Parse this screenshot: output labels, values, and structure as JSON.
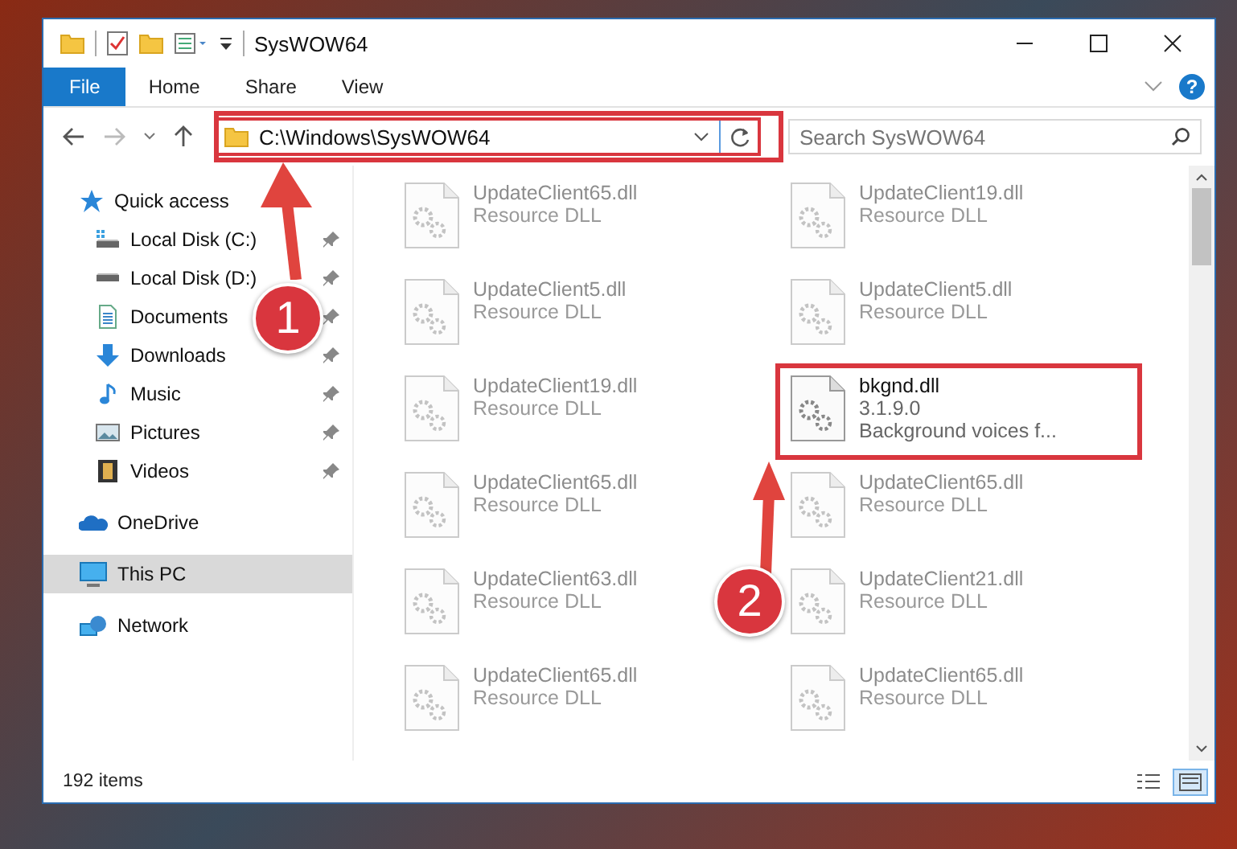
{
  "window": {
    "title": "SysWOW64"
  },
  "ribbon": {
    "tabs": [
      {
        "label": "File",
        "selected": true
      },
      {
        "label": "Home",
        "selected": false
      },
      {
        "label": "Share",
        "selected": false
      },
      {
        "label": "View",
        "selected": false
      }
    ],
    "help_label": "?"
  },
  "address_bar": {
    "path": "C:\\Windows\\SysWOW64"
  },
  "search": {
    "placeholder": "Search SysWOW64"
  },
  "sidebar": {
    "items": [
      {
        "label": "Quick access",
        "kind": "star",
        "selected": false,
        "children": [
          {
            "label": "Local Disk (C:)",
            "kind": "system-drive",
            "pinned": true,
            "selected": false
          },
          {
            "label": "Local Disk (D:)",
            "kind": "drive",
            "pinned": true,
            "selected": false
          },
          {
            "label": "Documents",
            "kind": "document",
            "pinned": true,
            "selected": false
          },
          {
            "label": "Downloads",
            "kind": "download",
            "pinned": true,
            "selected": false
          },
          {
            "label": "Music",
            "kind": "music",
            "pinned": true,
            "selected": false
          },
          {
            "label": "Pictures",
            "kind": "picture",
            "pinned": true,
            "selected": false
          },
          {
            "label": "Videos",
            "kind": "video",
            "pinned": true,
            "selected": false
          }
        ]
      },
      {
        "label": "OneDrive",
        "kind": "cloud",
        "selected": false
      },
      {
        "label": "This PC",
        "kind": "monitor",
        "selected": true
      },
      {
        "label": "Network",
        "kind": "network",
        "selected": false
      }
    ]
  },
  "files": [
    {
      "lines": [
        "UpdateClient65.dll",
        "Resource DLL"
      ],
      "faded": true,
      "highlighted": false
    },
    {
      "lines": [
        "UpdateClient19.dll",
        "Resource DLL"
      ],
      "faded": true,
      "highlighted": false
    },
    {
      "lines": [
        "UpdateClient5.dll",
        "Resource DLL"
      ],
      "faded": true,
      "highlighted": false
    },
    {
      "lines": [
        "UpdateClient5.dll",
        "Resource DLL"
      ],
      "faded": true,
      "highlighted": false
    },
    {
      "lines": [
        "UpdateClient19.dll",
        "Resource DLL"
      ],
      "faded": true,
      "highlighted": false
    },
    {
      "lines": [
        "bkgnd.dll",
        "3.1.9.0",
        "Background voices f..."
      ],
      "faded": false,
      "highlighted": true
    },
    {
      "lines": [
        "UpdateClient65.dll",
        "Resource DLL"
      ],
      "faded": true,
      "highlighted": false
    },
    {
      "lines": [
        "UpdateClient65.dll",
        "Resource DLL"
      ],
      "faded": true,
      "highlighted": false
    },
    {
      "lines": [
        "UpdateClient63.dll",
        "Resource DLL"
      ],
      "faded": true,
      "highlighted": false
    },
    {
      "lines": [
        "UpdateClient21.dll",
        "Resource DLL"
      ],
      "faded": true,
      "highlighted": false
    },
    {
      "lines": [
        "UpdateClient65.dll",
        "Resource DLL"
      ],
      "faded": true,
      "highlighted": false
    },
    {
      "lines": [
        "UpdateClient65.dll",
        "Resource DLL"
      ],
      "faded": true,
      "highlighted": false
    }
  ],
  "status_bar": {
    "item_count": "192 items",
    "view_modes": [
      {
        "kind": "details",
        "selected": false
      },
      {
        "kind": "tiles",
        "selected": true
      }
    ]
  },
  "annotations": [
    {
      "number": "1"
    },
    {
      "number": "2"
    }
  ]
}
